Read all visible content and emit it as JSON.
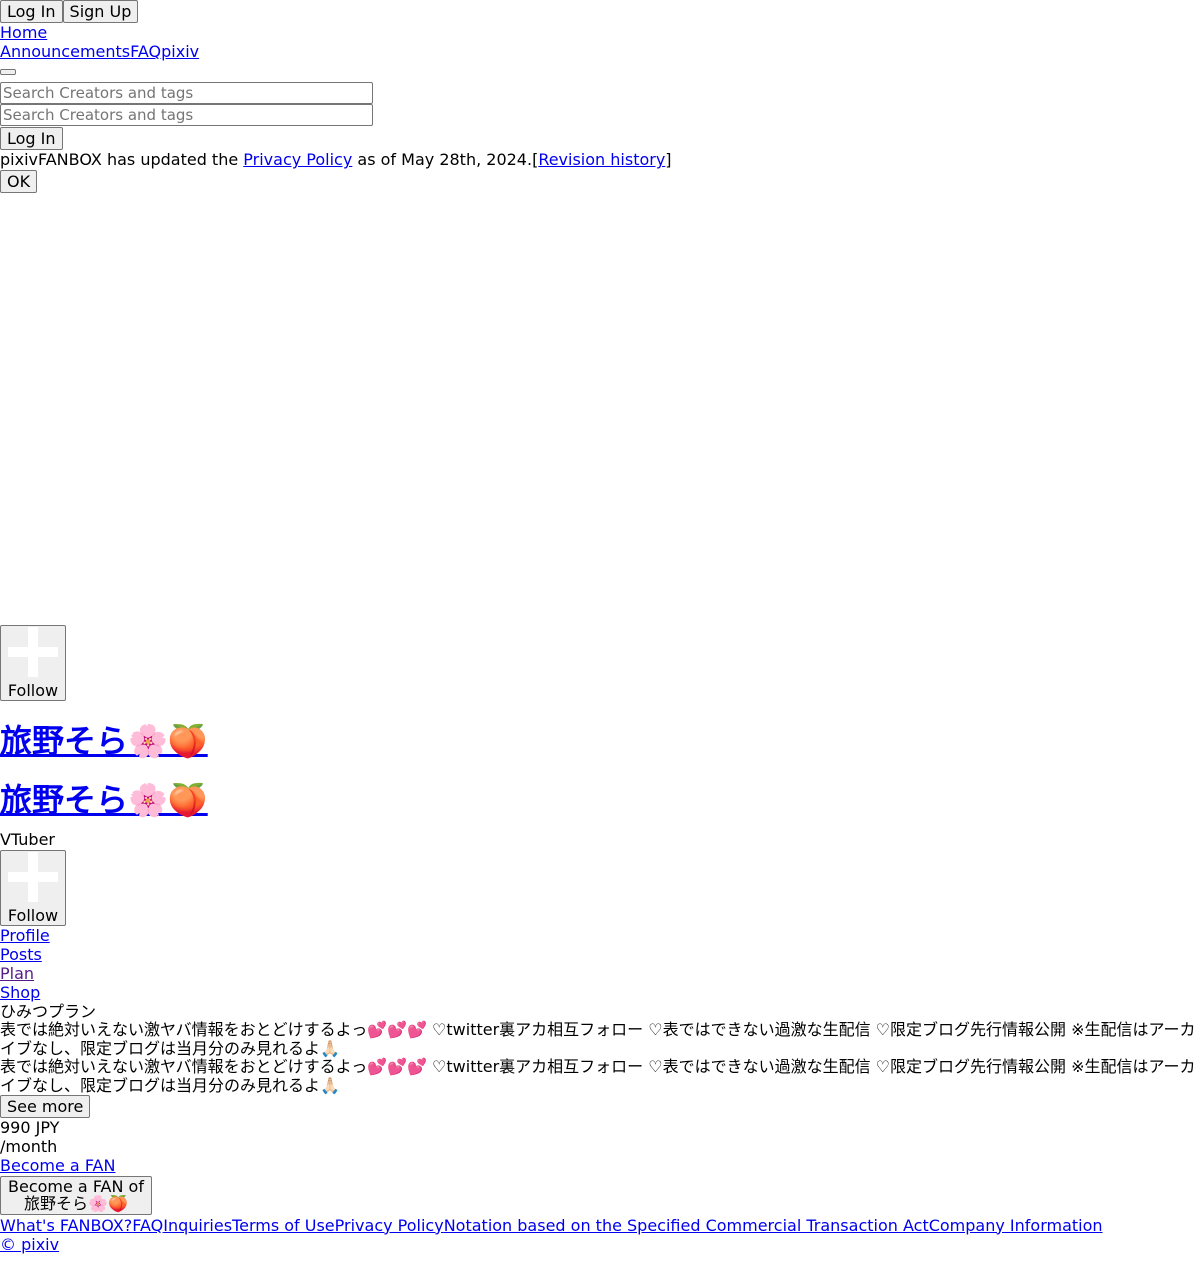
{
  "header": {
    "login_label": "Log In",
    "signup_label": "Sign Up",
    "home_label": "Home",
    "nav": {
      "announcements": "Announcements",
      "faq": "FAQ",
      "pixiv": "pixiv"
    },
    "search_placeholder": "Search Creators and tags",
    "login_label_2": "Log In"
  },
  "notice": {
    "prefix": "pixivFANBOX has updated the ",
    "policy_link": "Privacy Policy",
    "middle": " as of May 28th, 2024.[",
    "revision_link": "Revision history",
    "suffix": "]",
    "ok_label": "OK"
  },
  "creator": {
    "follow_label": "Follow",
    "name": "旅野そら🌸🍑",
    "category": "VTuber"
  },
  "tabs": {
    "profile": "Profile",
    "posts": "Posts",
    "plan": "Plan",
    "shop": "Shop"
  },
  "plan": {
    "name": "ひみつプラン",
    "description": "表では絶対いえない激ヤバ情報をおとどけするよっ💕💕💕 ♡twitter裏アカ相互フォロー ♡表ではできない過激な生配信 ♡限定ブログ先行情報公開 ※生配信はアーカイブなし、限定ブログは当月分のみ見れるよ🙏🏻",
    "see_more_label": "See more",
    "price": "990 JPY",
    "per_month": "/month",
    "become_fan_link": "Become a FAN",
    "become_fan_button_line1": "Become a FAN of",
    "become_fan_button_line2": "旅野そら🌸🍑"
  },
  "footer": {
    "links": [
      "What's FANBOX?",
      "FAQ",
      "Inquiries",
      "Terms of Use",
      "Privacy Policy",
      "Notation based on the Specified Commercial Transaction Act",
      "Company Information"
    ],
    "copyright": "© pixiv"
  },
  "colors": {
    "link": "#0000ee",
    "visited_link": "#551a8b",
    "button_bg": "#efefef",
    "button_border": "#767676"
  }
}
